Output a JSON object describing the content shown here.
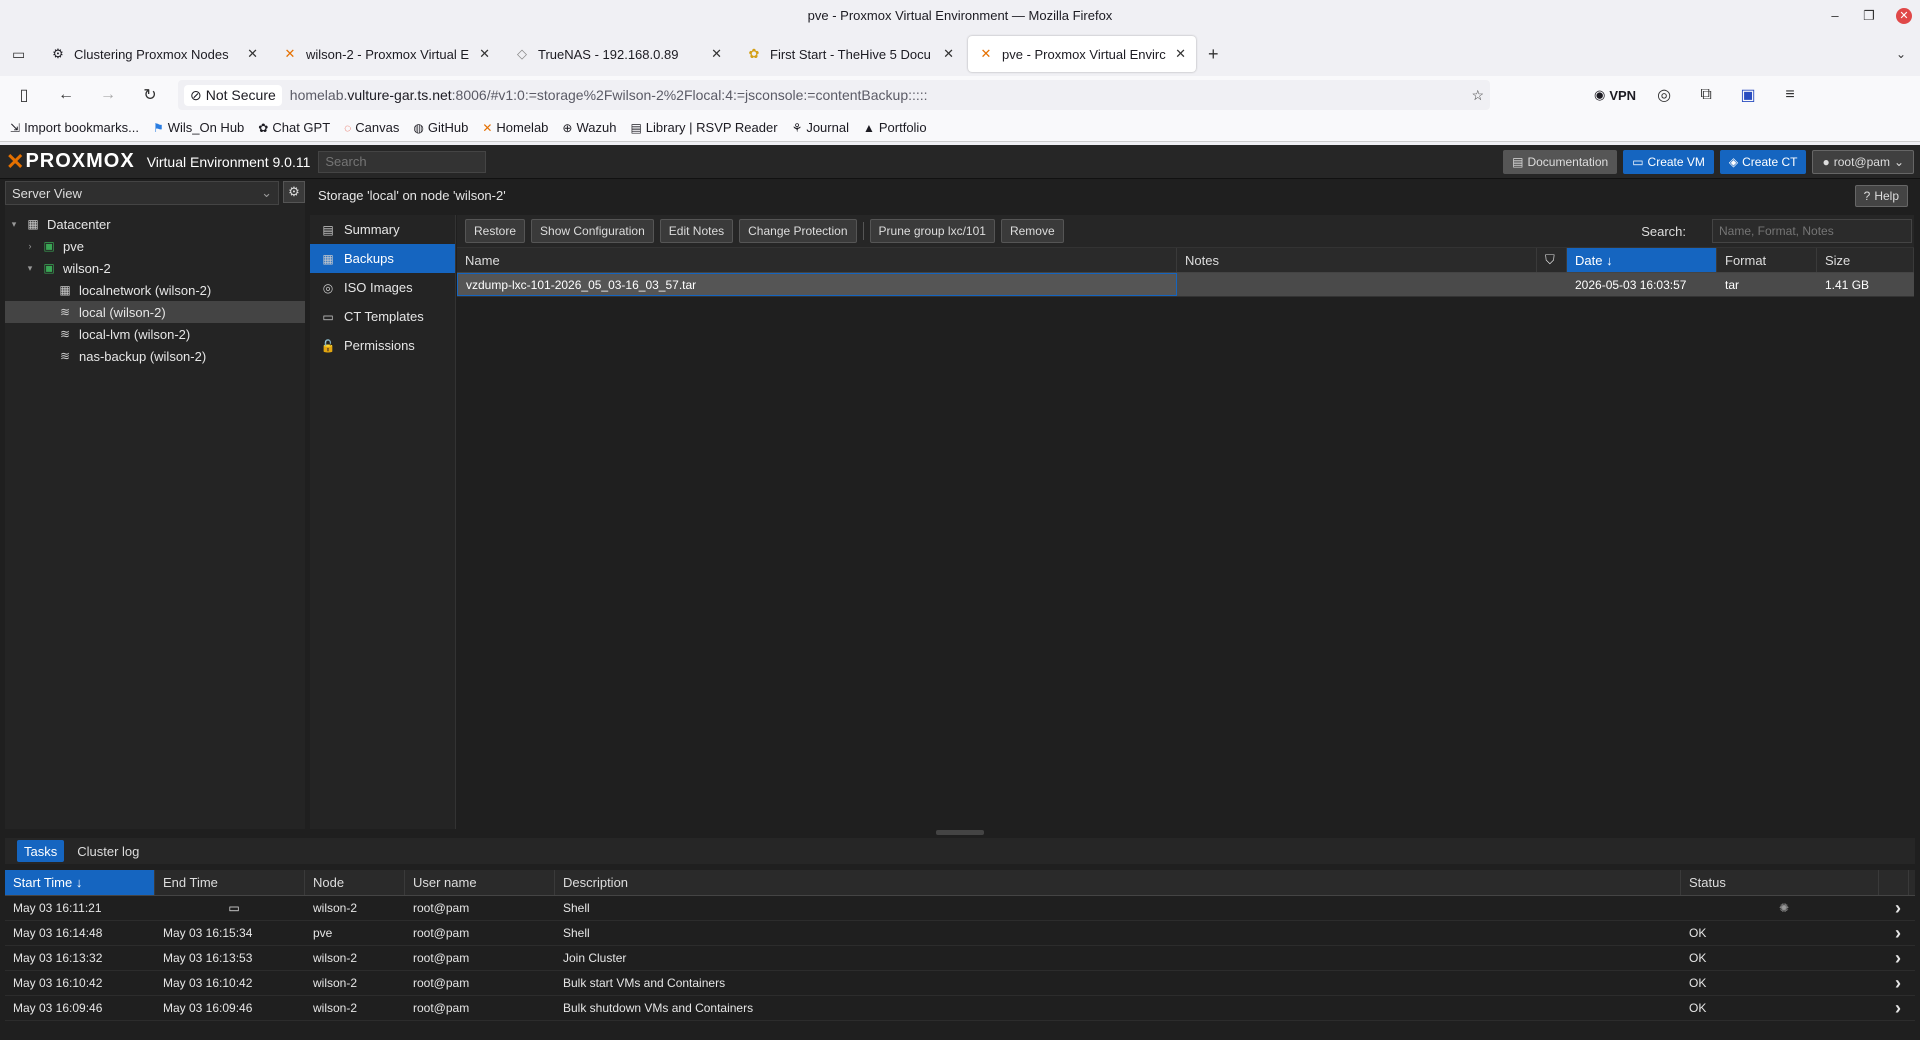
{
  "window": {
    "title": "pve - Proxmox Virtual Environment — Mozilla Firefox"
  },
  "tabs": [
    {
      "label": "Clustering Proxmox Nodes",
      "icon": "settings-icon",
      "active": false
    },
    {
      "label": "wilson-2 - Proxmox Virtual E",
      "icon": "proxmox-icon",
      "active": false
    },
    {
      "label": "TrueNAS - 192.168.0.89",
      "icon": "truenas-icon",
      "active": false
    },
    {
      "label": "First Start - TheHive 5 Docu",
      "icon": "thehive-icon",
      "active": false
    },
    {
      "label": "pve - Proxmox Virtual Envirc",
      "icon": "proxmox-icon",
      "active": true
    }
  ],
  "urlbar": {
    "security": "Not Secure",
    "url_prefix": "homelab.",
    "url_host": "vulture-gar.ts.net",
    "url_rest": ":8006/#v1:0:=storage%2Fwilson-2%2Flocal:4:=jsconsole:=contentBackup:::::",
    "vpn": "VPN"
  },
  "bookmarks": [
    {
      "label": "Import bookmarks...",
      "icon": "import-icon"
    },
    {
      "label": "Wils_On Hub",
      "icon": "flag-icon"
    },
    {
      "label": "Chat GPT",
      "icon": "openai-icon"
    },
    {
      "label": "Canvas",
      "icon": "canvas-icon"
    },
    {
      "label": "GitHub",
      "icon": "github-icon"
    },
    {
      "label": "Homelab",
      "icon": "proxmox-icon"
    },
    {
      "label": "Wazuh",
      "icon": "globe-icon"
    },
    {
      "label": "Library | RSVP Reader",
      "icon": "book-icon"
    },
    {
      "label": "Journal",
      "icon": "journal-icon"
    },
    {
      "label": "Portfolio",
      "icon": "portfolio-icon"
    }
  ],
  "pve": {
    "logo": "PROXMOX",
    "version": "Virtual Environment 9.0.11",
    "search_placeholder": "Search",
    "buttons": {
      "docs": "Documentation",
      "create_vm": "Create VM",
      "create_ct": "Create CT",
      "user": "root@pam"
    },
    "view": "Server View",
    "tree": [
      {
        "label": "Datacenter",
        "level": 0,
        "icon": "datacenter-icon",
        "arrow": "▾"
      },
      {
        "label": "pve",
        "level": 1,
        "icon": "node-icon",
        "arrow": "›"
      },
      {
        "label": "wilson-2",
        "level": 1,
        "icon": "node-icon",
        "arrow": "▾"
      },
      {
        "label": "localnetwork (wilson-2)",
        "level": 2,
        "icon": "network-icon",
        "arrow": ""
      },
      {
        "label": "local (wilson-2)",
        "level": 2,
        "icon": "storage-icon",
        "arrow": "",
        "selected": true
      },
      {
        "label": "local-lvm (wilson-2)",
        "level": 2,
        "icon": "storage-icon",
        "arrow": ""
      },
      {
        "label": "nas-backup (wilson-2)",
        "level": 2,
        "icon": "storage-icon",
        "arrow": ""
      }
    ],
    "page_title": "Storage 'local' on node 'wilson-2'",
    "help": "Help",
    "menu": [
      {
        "label": "Summary",
        "icon": "book-icon"
      },
      {
        "label": "Backups",
        "icon": "backup-icon",
        "selected": true
      },
      {
        "label": "ISO Images",
        "icon": "disc-icon"
      },
      {
        "label": "CT Templates",
        "icon": "template-icon"
      },
      {
        "label": "Permissions",
        "icon": "unlock-icon"
      }
    ],
    "toolbar": [
      "Restore",
      "Show Configuration",
      "Edit Notes",
      "Change Protection",
      "Prune group lxc/101",
      "Remove"
    ],
    "search_label": "Search:",
    "search_placeholder_grid": "Name, Format, Notes",
    "columns": [
      "Name",
      "Notes",
      "",
      "Date ↓",
      "Format",
      "Size"
    ],
    "rows": [
      {
        "name": "vzdump-lxc-101-2026_05_03-16_03_57.tar",
        "notes": "",
        "date": "2026-05-03 16:03:57",
        "format": "tar",
        "size": "1.41 GB"
      }
    ],
    "task_tabs": [
      "Tasks",
      "Cluster log"
    ],
    "task_columns": [
      "Start Time ↓",
      "End Time",
      "Node",
      "User name",
      "Description",
      "Status"
    ],
    "tasks": [
      {
        "start": "May 03 16:11:21",
        "end": "",
        "node": "wilson-2",
        "user": "root@pam",
        "desc": "Shell",
        "status": ""
      },
      {
        "start": "May 03 16:14:48",
        "end": "May 03 16:15:34",
        "node": "pve",
        "user": "root@pam",
        "desc": "Shell",
        "status": "OK"
      },
      {
        "start": "May 03 16:13:32",
        "end": "May 03 16:13:53",
        "node": "wilson-2",
        "user": "root@pam",
        "desc": "Join Cluster",
        "status": "OK"
      },
      {
        "start": "May 03 16:10:42",
        "end": "May 03 16:10:42",
        "node": "wilson-2",
        "user": "root@pam",
        "desc": "Bulk start VMs and Containers",
        "status": "OK"
      },
      {
        "start": "May 03 16:09:46",
        "end": "May 03 16:09:46",
        "node": "wilson-2",
        "user": "root@pam",
        "desc": "Bulk shutdown VMs and Containers",
        "status": "OK"
      }
    ]
  }
}
